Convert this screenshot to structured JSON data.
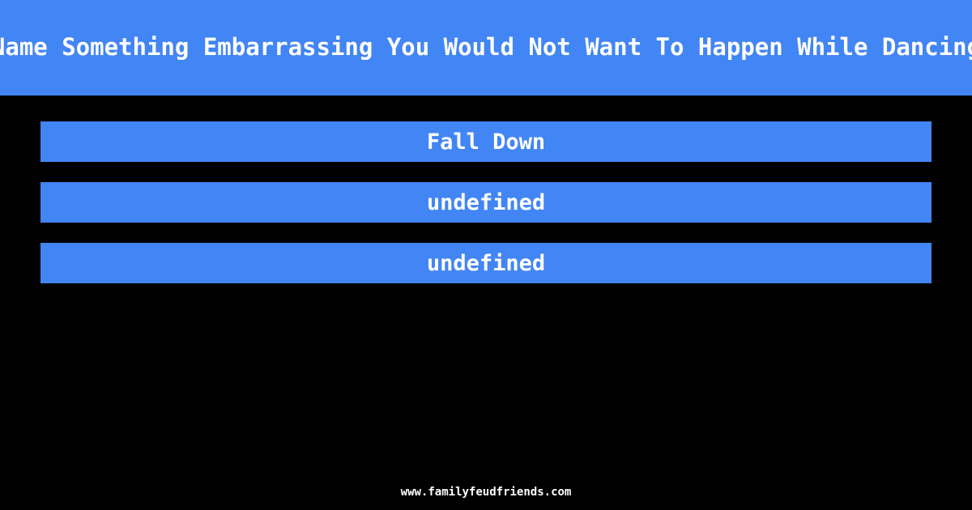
{
  "theme": {
    "background_color": "#000000",
    "accent_color": "#4285f4",
    "text_color": "#ffffff"
  },
  "header": {
    "question": "Name Something Embarrassing You Would Not Want To Happen While Dancing"
  },
  "answers": {
    "items": [
      {
        "label": "Fall Down"
      },
      {
        "label": "undefined"
      },
      {
        "label": "undefined"
      }
    ]
  },
  "footer": {
    "site": "www.familyfeudfriends.com"
  }
}
